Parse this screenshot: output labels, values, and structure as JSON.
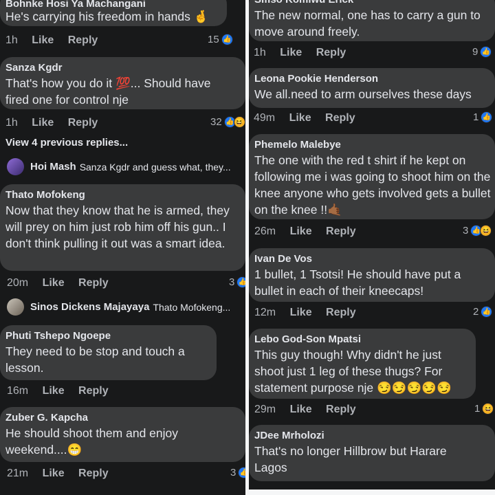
{
  "left": {
    "comments": [
      {
        "name": "Bohnke Hosi Ya Machangani",
        "text": "He's carrying his freedom in hands 🤞",
        "time": "1h",
        "like": "Like",
        "reply": "Reply",
        "count": "15"
      },
      {
        "name": "Sanza Kgdr",
        "text": "That's how you do it 💯... Should have fired one for control nje",
        "time": "1h",
        "like": "Like",
        "reply": "Reply",
        "count": "32"
      },
      {
        "name": "Thato Mofokeng",
        "text": "Now that they know that he is armed, they will prey on him just rob him off his gun.. I don't think pulling it out was a smart idea.",
        "time": "20m",
        "like": "Like",
        "reply": "Reply",
        "count": "3"
      },
      {
        "name": "Phuti Tshepo Ngoepe",
        "text": "They need to be stop and touch a lesson.",
        "time": "16m",
        "like": "Like",
        "reply": "Reply",
        "count": ""
      },
      {
        "name": "Zuber G. Kapcha",
        "text": "He should shoot them and enjoy weekend....😁",
        "time": "21m",
        "like": "Like",
        "reply": "Reply",
        "count": "3"
      }
    ],
    "view_previous": "View 4 previous replies...",
    "replies": [
      {
        "name": "Hoi Mash",
        "text": "Sanza Kgdr and guess what, they..."
      },
      {
        "name": "Sinos Dickens Majayaya",
        "text": "Thato Mofokeng..."
      }
    ]
  },
  "right": {
    "comments": [
      {
        "name": "Sifiso Komiwu Erick",
        "text": "The new normal, one has to carry a gun to move around freely.",
        "time": "1h",
        "like": "Like",
        "reply": "Reply",
        "count": "9"
      },
      {
        "name": "Leona Pookie Henderson",
        "text": "We all.need to arm ourselves these days",
        "time": "49m",
        "like": "Like",
        "reply": "Reply",
        "count": "1"
      },
      {
        "name": "Phemelo Malebye",
        "text": "The one with the red t shirt if he kept on following me i was going to shoot him on the knee anyone who gets involved gets a bullet on the knee !!🤙🏾",
        "time": "26m",
        "like": "Like",
        "reply": "Reply",
        "count": "3"
      },
      {
        "name": "Ivan De Vos",
        "text": "1 bullet, 1 Tsotsi! He should have put a bullet in each of their kneecaps!",
        "time": "12m",
        "like": "Like",
        "reply": "Reply",
        "count": "2"
      },
      {
        "name": "Lebo God-Son Mpatsi",
        "text": "This guy though! Why didn't he just shoot just 1 leg of these thugs? For statement purpose nje 😏😏😏😏😏",
        "time": "29m",
        "like": "Like",
        "reply": "Reply",
        "count": "1"
      },
      {
        "name": "JDee Mrholozi",
        "text": "That's no longer Hillbrow but Harare Lagos",
        "time": "",
        "like": "",
        "reply": "",
        "count": ""
      }
    ]
  },
  "colors": {
    "bubble": "#3a3b3c",
    "background": "#18191a",
    "like": "#2078f4",
    "haha": "#f7b125",
    "divider": "#f5f6f7"
  }
}
